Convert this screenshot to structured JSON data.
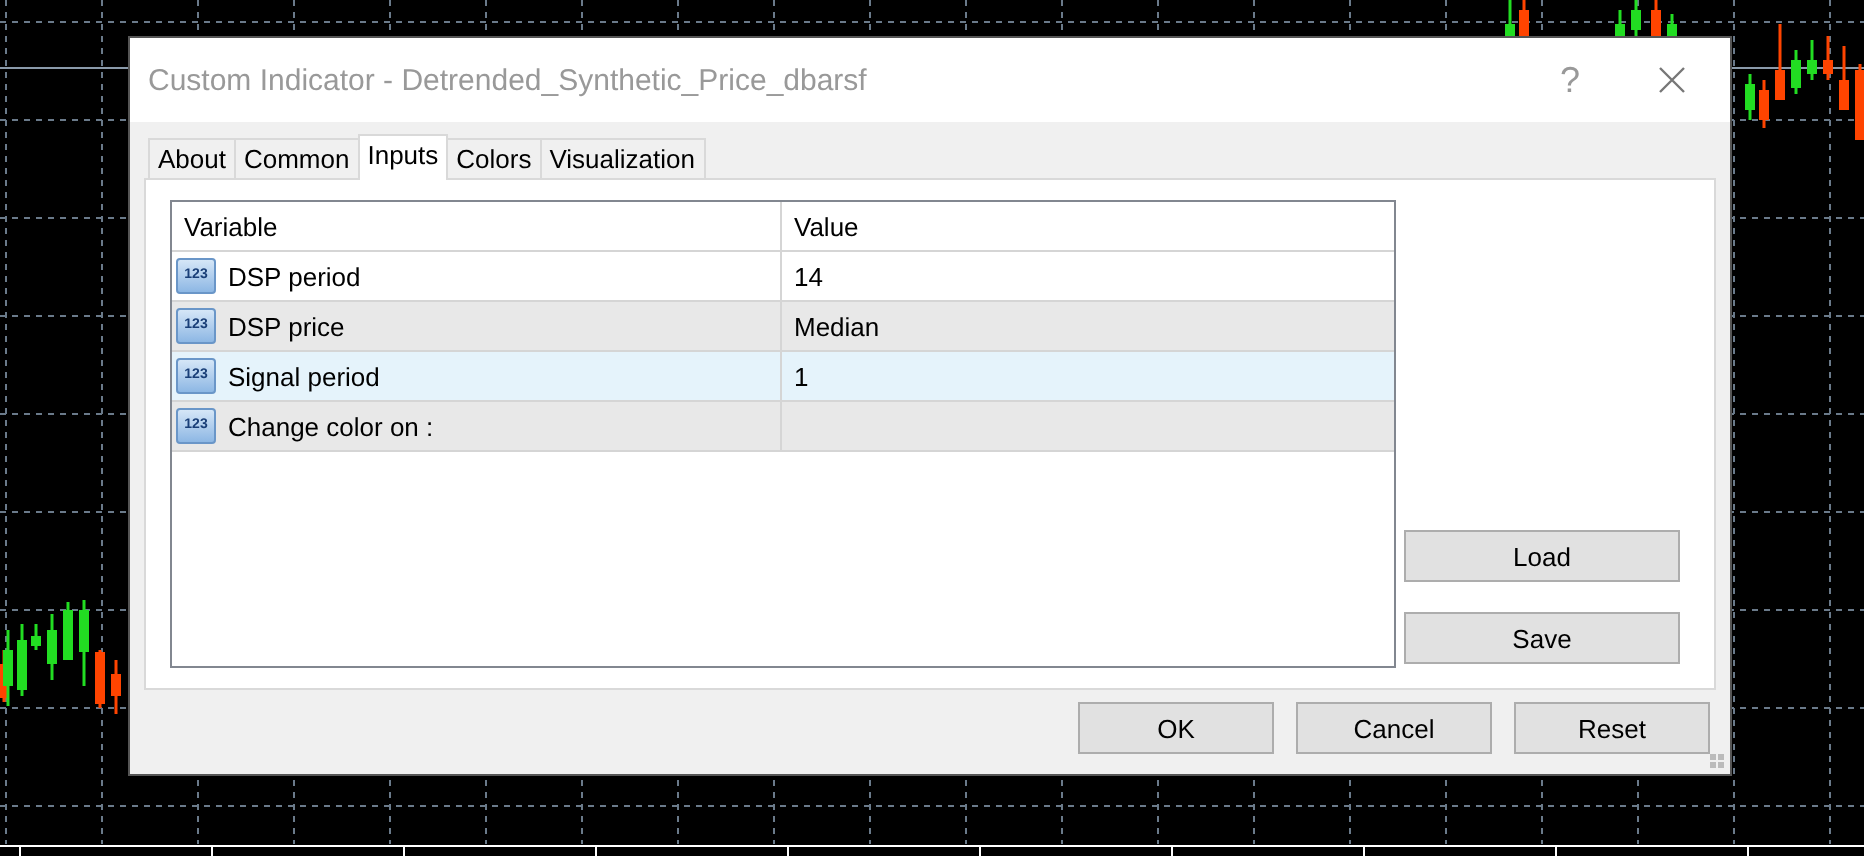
{
  "window": {
    "title": "Custom Indicator - Detrended_Synthetic_Price_dbarsf",
    "help": "?"
  },
  "tabs": [
    {
      "label": "About",
      "selected": false
    },
    {
      "label": "Common",
      "selected": false
    },
    {
      "label": "Inputs",
      "selected": true
    },
    {
      "label": "Colors",
      "selected": false
    },
    {
      "label": "Visualization",
      "selected": false
    }
  ],
  "table": {
    "columns": [
      "Variable",
      "Value"
    ],
    "rows": [
      {
        "type_badge": "123",
        "variable": "DSP period",
        "value": "14",
        "selected": false
      },
      {
        "type_badge": "123",
        "variable": "DSP price",
        "value": "Median",
        "selected": false
      },
      {
        "type_badge": "123",
        "variable": "Signal period",
        "value": "1",
        "selected": true
      },
      {
        "type_badge": "123",
        "variable": "Change color on :",
        "selected": false
      }
    ]
  },
  "side_buttons": [
    "Load",
    "Save"
  ],
  "buttons": [
    "OK",
    "Cancel",
    "Reset"
  ]
}
